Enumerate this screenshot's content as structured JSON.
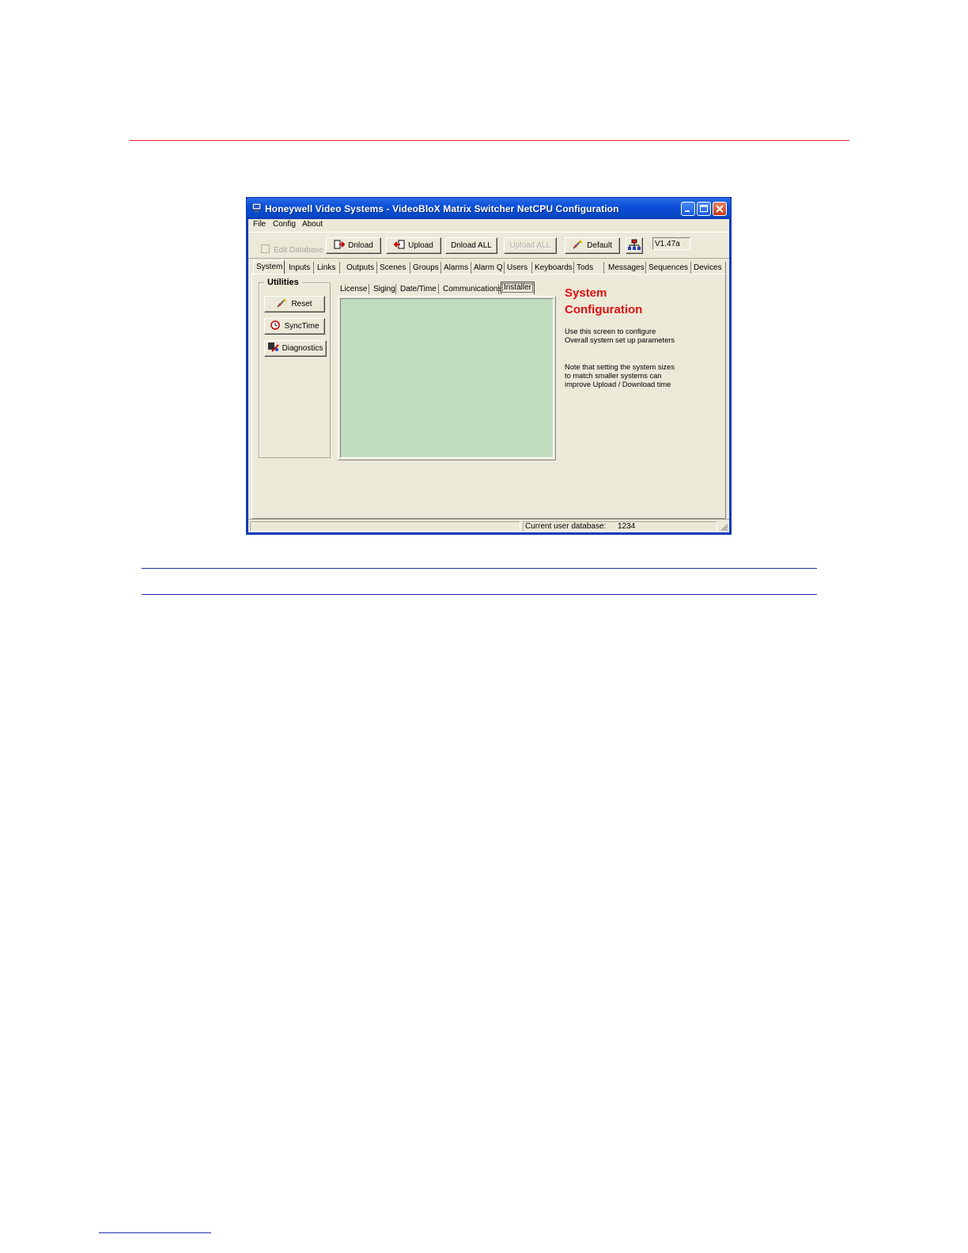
{
  "window": {
    "title": "Honeywell Video Systems - VideoBloX Matrix Switcher NetCPU Configuration"
  },
  "menu": [
    "File",
    "Config",
    "About"
  ],
  "toolbar": {
    "edit_database": "Edit Database",
    "dnload": "Dnload",
    "upload": "Upload",
    "dnload_all": "Dnload ALL",
    "upload_all": "Upload ALL",
    "default": "Default",
    "version": "V1.47a"
  },
  "tabs": [
    "System",
    "Inputs",
    "Links",
    "Outputs",
    "Scenes",
    "Groups",
    "Alarms",
    "Alarm Q",
    "Users",
    "Keyboards",
    "Tods",
    "Messages",
    "Sequences",
    "Devices"
  ],
  "utilities": {
    "label": "Utilities",
    "reset": "Reset",
    "synctime": "SyncTime",
    "diagnostics": "Diagnostics"
  },
  "subtabs": [
    "License",
    "Siging",
    "Date/Time",
    "Communications",
    "Installer"
  ],
  "info": {
    "title_line1": "System",
    "title_line2": "Configuration",
    "desc1": "Use this screen to configure Overall system set up parameters",
    "desc2": "Note that setting the system sizes to match smaller systems can improve Upload / Download time"
  },
  "status": {
    "label": "Current user database:",
    "value": "1234"
  },
  "colors": {
    "title_red": "#e01010",
    "green_area": "#c0dcc0",
    "window_bg": "#ece9d8",
    "titlebar": "#0a4fd8"
  }
}
